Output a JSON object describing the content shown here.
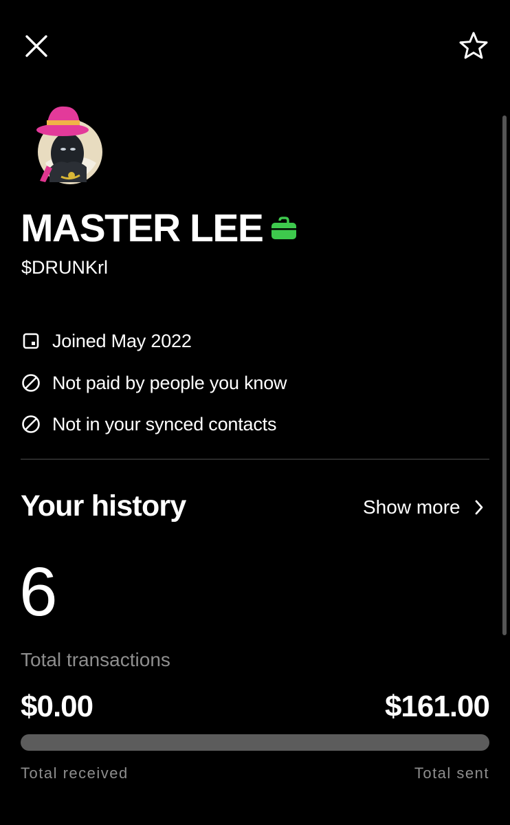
{
  "header": {
    "close_icon": "close-icon",
    "favorite_icon": "star-outline-icon"
  },
  "profile": {
    "name": "MASTER LEE",
    "business_badge_icon": "briefcase-icon",
    "business_badge_color": "#3ec94d",
    "cashtag": "$DRUNKrl"
  },
  "info": [
    {
      "icon": "calendar-icon",
      "text": "Joined May 2022"
    },
    {
      "icon": "not-allowed-icon",
      "text": "Not paid by people you know"
    },
    {
      "icon": "not-allowed-icon",
      "text": "Not in your synced contacts"
    }
  ],
  "history": {
    "title": "Your history",
    "show_more_label": "Show more",
    "transaction_count": "6",
    "transaction_count_label": "Total transactions",
    "total_received": "$0.00",
    "total_sent": "$161.00",
    "received_fraction": 0.0,
    "total_received_label": "Total received",
    "total_sent_label": "Total sent"
  }
}
